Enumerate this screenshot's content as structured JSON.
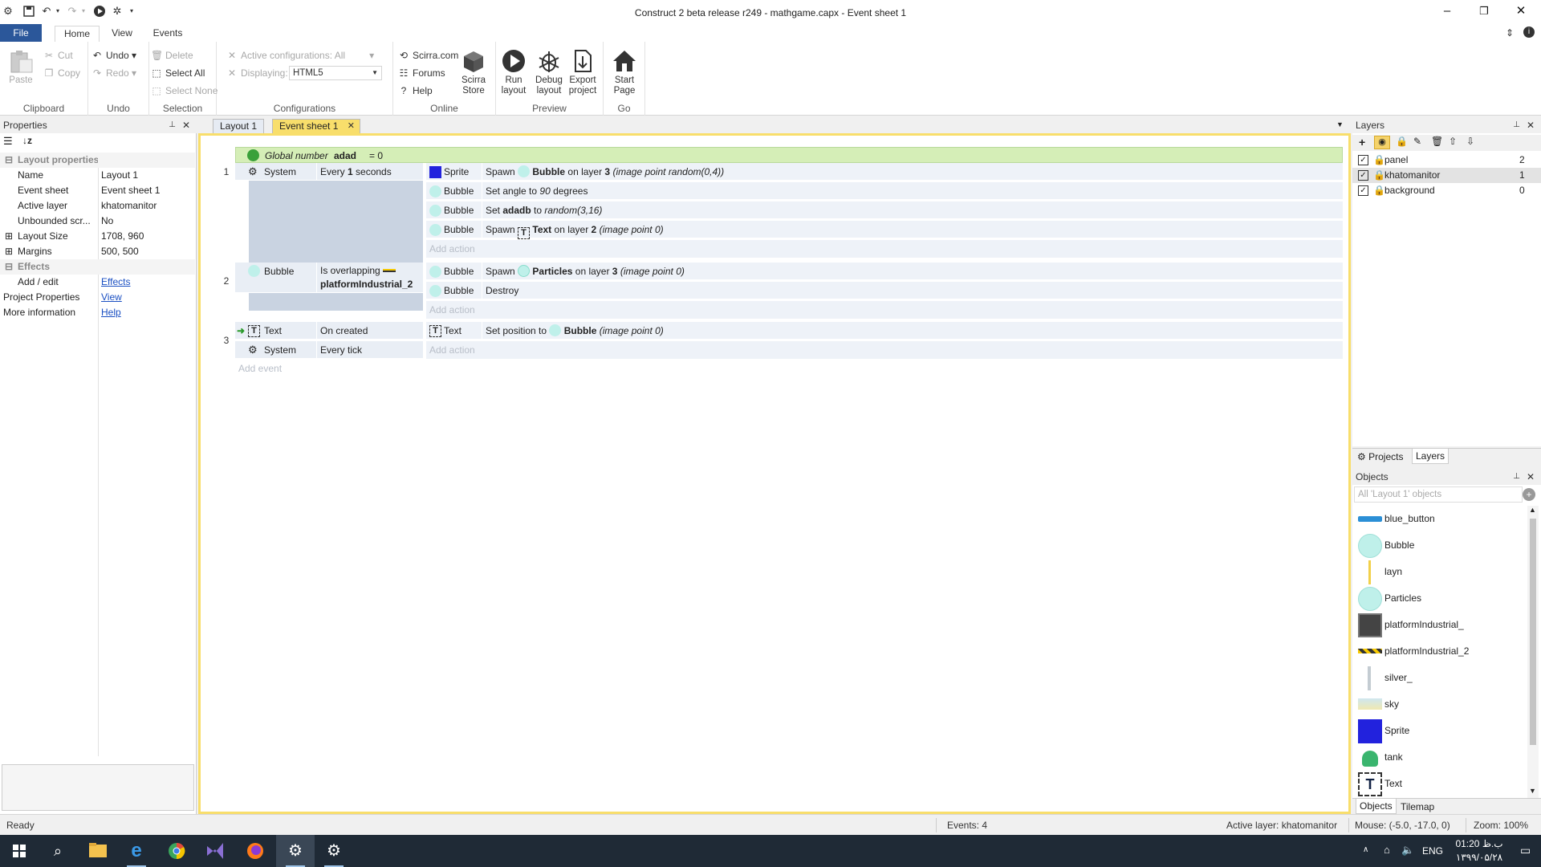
{
  "window": {
    "title": "Construct 2 beta release r249 - mathgame.capx - Event sheet 1",
    "controls": {
      "minimize": "–",
      "maximize": "❐",
      "close": "✕"
    }
  },
  "ribbon": {
    "tabs": [
      "File",
      "Home",
      "View",
      "Events"
    ],
    "active_tab": "Home",
    "clipboard": {
      "paste": "Paste",
      "cut": "Cut",
      "copy": "Copy",
      "label": "Clipboard"
    },
    "undo": {
      "undo": "Undo",
      "redo": "Redo",
      "label": "Undo"
    },
    "selection": {
      "delete": "Delete",
      "select_all": "Select All",
      "select_none": "Select None",
      "label": "Selection"
    },
    "configurations": {
      "active": "Active configurations: All",
      "displaying_label": "Displaying:",
      "displaying_value": "HTML5",
      "label": "Configurations"
    },
    "online": {
      "scirra": "Scirra.com",
      "forums": "Forums",
      "help": "Help",
      "store_l1": "Scirra",
      "store_l2": "Store",
      "label": "Online"
    },
    "preview": {
      "run_l1": "Run",
      "run_l2": "layout",
      "debug_l1": "Debug",
      "debug_l2": "layout",
      "export_l1": "Export",
      "export_l2": "project",
      "label": "Preview"
    },
    "go": {
      "start_l1": "Start",
      "start_l2": "Page",
      "label": "Go"
    }
  },
  "properties": {
    "title": "Properties",
    "sections": {
      "layout": "Layout properties",
      "effects": "Effects"
    },
    "rows": {
      "name": {
        "k": "Name",
        "v": "Layout 1"
      },
      "event_sheet": {
        "k": "Event sheet",
        "v": "Event sheet 1"
      },
      "active_layer": {
        "k": "Active layer",
        "v": "khatomanitor"
      },
      "unbounded": {
        "k": "Unbounded scr...",
        "v": "No"
      },
      "layout_size": {
        "k": "Layout Size",
        "v": "1708, 960"
      },
      "margins": {
        "k": "Margins",
        "v": "500, 500"
      },
      "add_edit": {
        "k": "Add / edit",
        "v": "Effects"
      },
      "project_props": {
        "k": "Project Properties",
        "v": "View"
      },
      "more_info": {
        "k": "More information",
        "v": "Help"
      }
    }
  },
  "doc_tabs": [
    "Layout 1",
    "Event sheet 1"
  ],
  "event_sheet": {
    "global": {
      "label": "Global number",
      "name": "adad",
      "rest": "= 0"
    },
    "events": {
      "e1": {
        "num": "1",
        "cond_obj": "System",
        "cond_a": "Every ",
        "cond_b": "1",
        "cond_c": " seconds",
        "a1_obj": "Sprite",
        "a1_verb": "Spawn",
        "a1_target": "Bubble",
        "a1_mid": " on layer ",
        "a1_layer": "3",
        "a1_extra": " (image point random(0,4))",
        "a2_obj": "Bubble",
        "a2_a": "Set angle to ",
        "a2_b": "90",
        "a2_c": " degrees",
        "a3_obj": "Bubble",
        "a3_a": "Set ",
        "a3_b": "adadb",
        "a3_c": " to ",
        "a3_d": "random(3,16)",
        "a4_obj": "Bubble",
        "a4_verb": "Spawn",
        "a4_target": "Text",
        "a4_mid": " on layer ",
        "a4_layer": "2",
        "a4_extra": " (image point 0)",
        "add_action": "Add action"
      },
      "e2": {
        "num": "2",
        "cond_obj": "Bubble",
        "cond_a": "Is overlapping",
        "cond_b": "platformIndustrial_2",
        "a1_obj": "Bubble",
        "a1_verb": "Spawn",
        "a1_target": "Particles",
        "a1_mid": " on layer ",
        "a1_layer": "3",
        "a1_extra": " (image point 0)",
        "a2_obj": "Bubble",
        "a2_verb": "Destroy",
        "add_action": "Add action"
      },
      "e3": {
        "num": "3",
        "c1_obj": "Text",
        "c1_text": "On created",
        "c2_obj": "System",
        "c2_text": "Every tick",
        "a1_obj": "Text",
        "a1_a": "Set position to ",
        "a1_target": "Bubble",
        "a1_extra": " (image point 0)",
        "add_action": "Add action"
      }
    },
    "add_event": "Add event"
  },
  "layers_panel": {
    "title": "Layers",
    "layers": [
      {
        "name": "panel",
        "index": "2"
      },
      {
        "name": "khatomanitor",
        "index": "1"
      },
      {
        "name": "background",
        "index": "0"
      }
    ],
    "bottom_tabs": [
      "Projects",
      "Layers"
    ]
  },
  "objects_panel": {
    "title": "Objects",
    "filter_placeholder": "All 'Layout 1' objects",
    "items": [
      "blue_button",
      "Bubble",
      "layn",
      "Particles",
      "platformIndustrial_",
      "platformIndustrial_2",
      "silver_",
      "sky",
      "Sprite",
      "tank",
      "Text"
    ],
    "bottom_tabs": [
      "Objects",
      "Tilemap"
    ]
  },
  "statusbar": {
    "ready": "Ready",
    "events": "Events: 4",
    "active_layer": "Active layer: khatomanitor",
    "mouse": "Mouse: (-5.0, -17.0, 0)",
    "zoom": "Zoom: 100%"
  },
  "taskbar": {
    "lang": "ENG",
    "time": "01:20 ب.ظ",
    "date": "۱۳۹۹/۰۵/۲۸"
  },
  "colors": {
    "accent_blue": "#2b579a",
    "sheet_border": "#f8de6b",
    "global_bg": "#d5eeb7",
    "condition_bg": "#e9eef5",
    "action_bg": "#eef2f8",
    "sprite_color": "#2222dd",
    "bubble_color": "#bff0ea"
  }
}
